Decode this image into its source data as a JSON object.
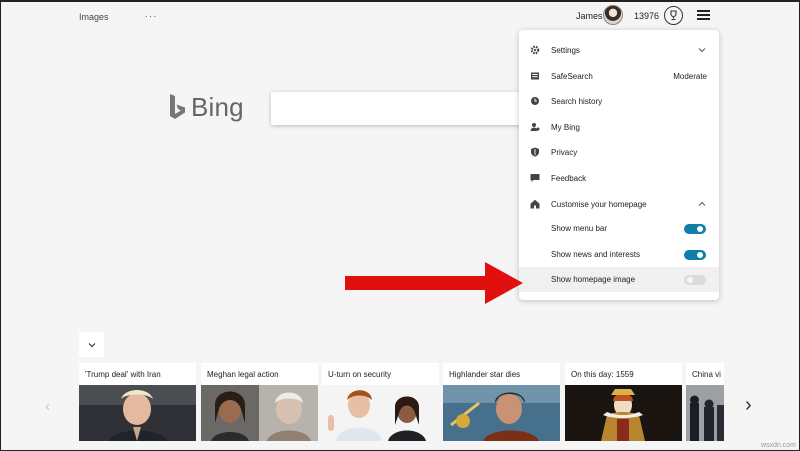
{
  "header": {
    "images_link": "Images",
    "more_dots": "···",
    "username": "James",
    "points": "13976"
  },
  "logo": {
    "text": "Bing"
  },
  "menu": {
    "items": [
      {
        "label": "Settings",
        "icon": "gear-icon",
        "expandable": true
      },
      {
        "label": "SafeSearch",
        "icon": "safesearch-icon",
        "value": "Moderate"
      },
      {
        "label": "Search history",
        "icon": "history-icon"
      },
      {
        "label": "My Bing",
        "icon": "person-icon"
      },
      {
        "label": "Privacy",
        "icon": "shield-icon"
      },
      {
        "label": "Feedback",
        "icon": "feedback-icon"
      },
      {
        "label": "Customise your homepage",
        "icon": "home-icon",
        "expanded": true
      }
    ],
    "homepage_options": [
      {
        "label": "Show menu bar",
        "on": true
      },
      {
        "label": "Show news and interests",
        "on": true
      },
      {
        "label": "Show homepage image",
        "on": false
      }
    ]
  },
  "news": {
    "cards": [
      {
        "title": "'Trump deal' with Iran"
      },
      {
        "title": "Meghan legal action"
      },
      {
        "title": "U-turn on security"
      },
      {
        "title": "Highlander star dies"
      },
      {
        "title": "On this day: 1559"
      },
      {
        "title": "China vi"
      }
    ]
  },
  "watermark": "wsxdn.com",
  "colors": {
    "accent_toggle": "#0e7fa6",
    "arrow": "#e0100f",
    "background": "#f5f5f5"
  }
}
